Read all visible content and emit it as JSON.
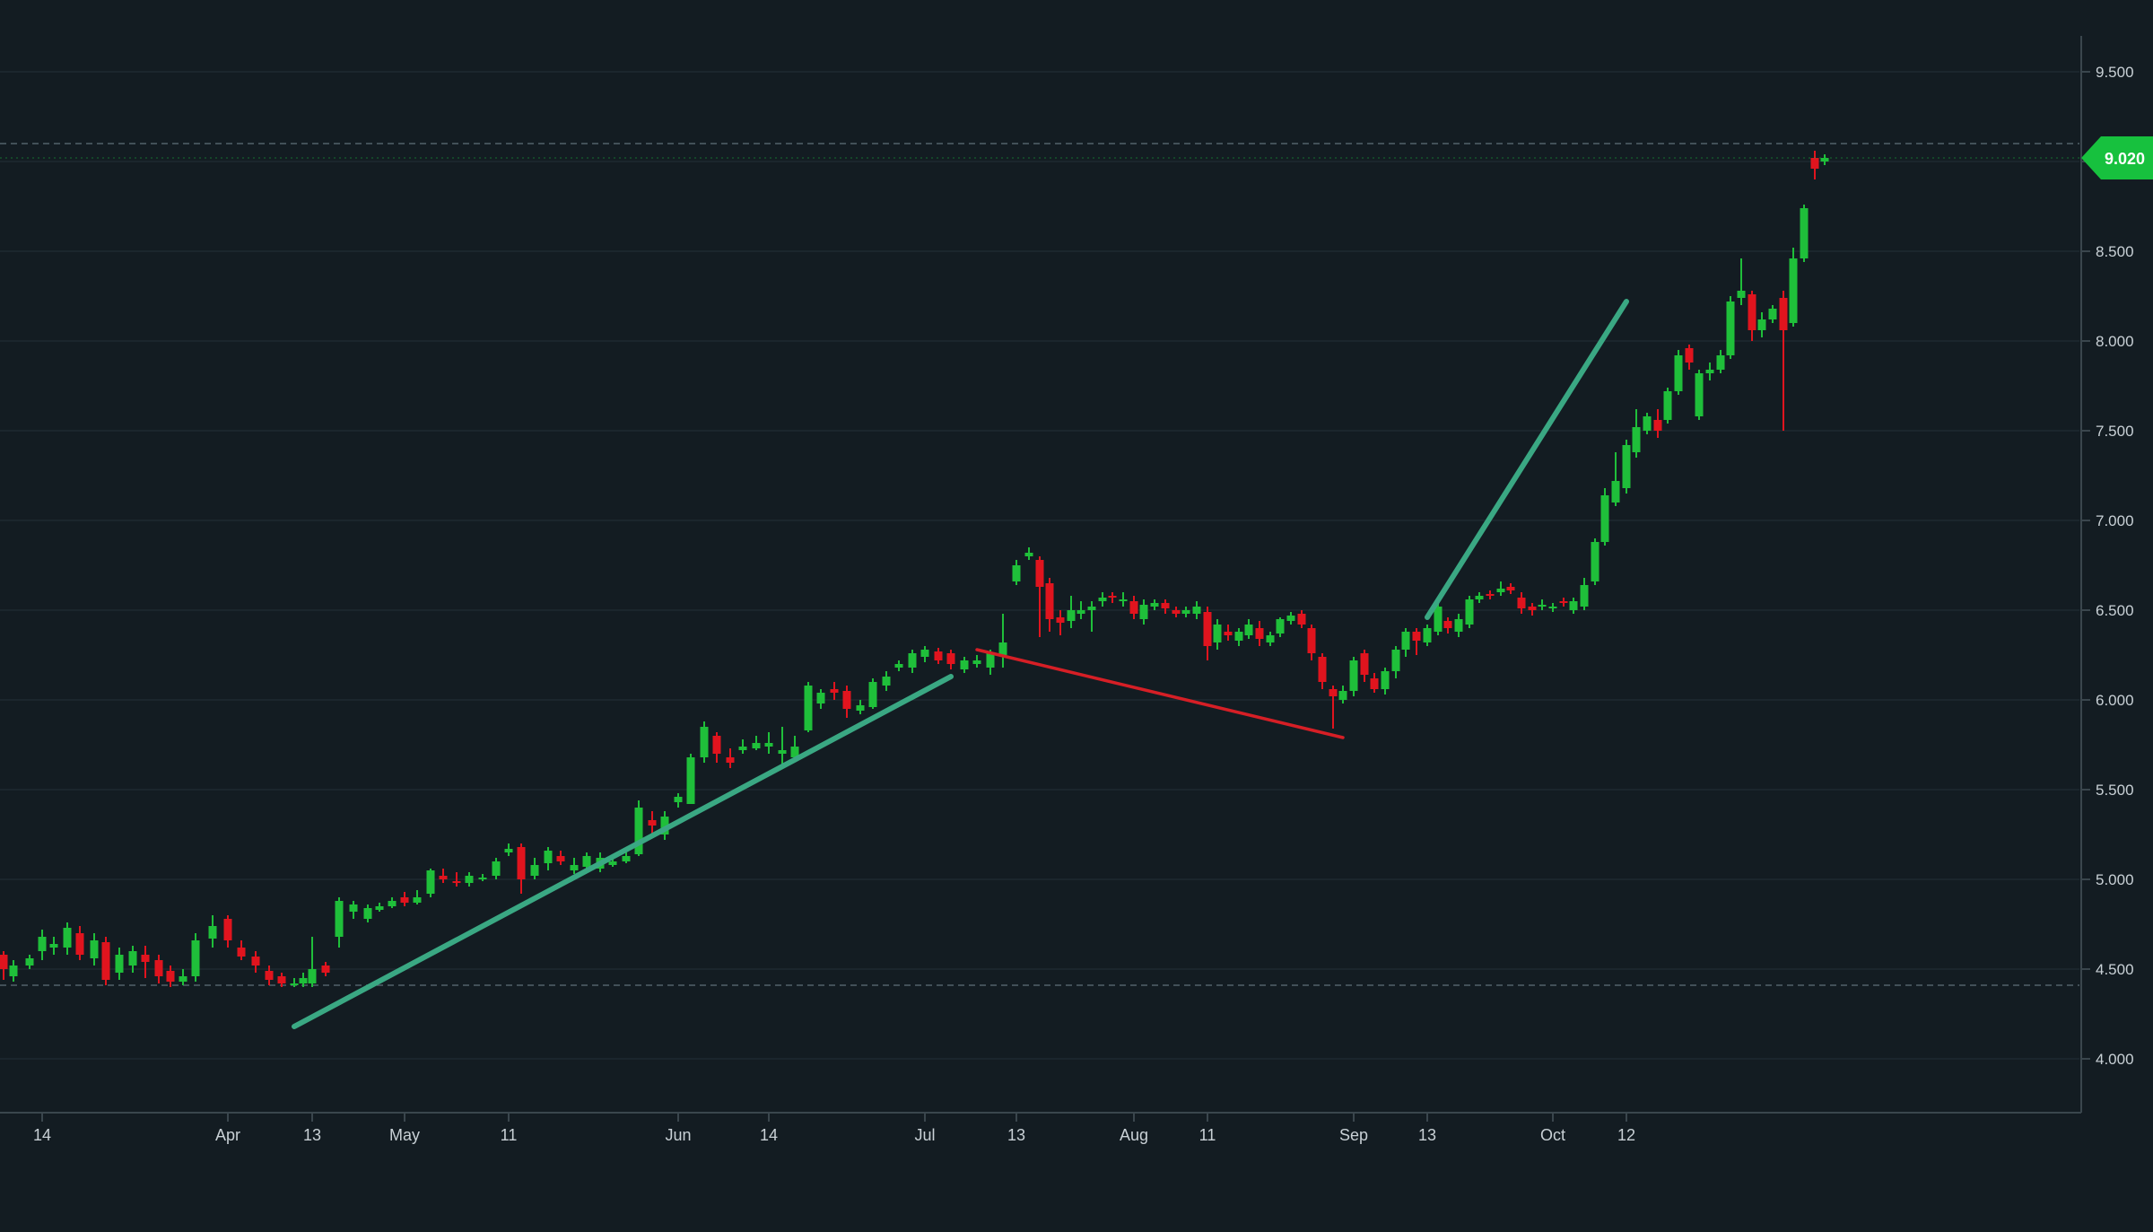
{
  "chart_data": {
    "type": "candlestick",
    "colors": {
      "background": "#131c22",
      "grid": "#1e2a31",
      "axis": "#3a464d",
      "axis_text": "#c9d1d6",
      "up": "#1fbf3a",
      "down": "#e0141e",
      "trend_up": "#3aa883",
      "trend_down": "#d61f26",
      "last_price_bg": "#17c13e",
      "last_price_text": "#ffffff",
      "dashed": "#52616a"
    },
    "y_axis": {
      "min": 3.7,
      "max": 9.6,
      "ticks": [
        "4.000",
        "4.500",
        "5.000",
        "5.500",
        "6.000",
        "6.500",
        "7.000",
        "7.500",
        "8.000",
        "8.500",
        "9.000",
        "9.500"
      ],
      "tick_values": [
        4.0,
        4.5,
        5.0,
        5.5,
        6.0,
        6.5,
        7.0,
        7.5,
        8.0,
        8.5,
        9.0,
        9.5
      ]
    },
    "x_axis": {
      "labels": [
        {
          "text": "14",
          "i": 3
        },
        {
          "text": "Apr",
          "i": 17
        },
        {
          "text": "13",
          "i": 24
        },
        {
          "text": "May",
          "i": 31
        },
        {
          "text": "11",
          "i": 39
        },
        {
          "text": "Jun",
          "i": 52
        },
        {
          "text": "14",
          "i": 59
        },
        {
          "text": "Jul",
          "i": 71
        },
        {
          "text": "13",
          "i": 78
        },
        {
          "text": "Aug",
          "i": 89
        },
        {
          "text": "11",
          "i": 96
        },
        {
          "text": "Sep",
          "i": 110
        },
        {
          "text": "13",
          "i": 117
        },
        {
          "text": "Oct",
          "i": 129
        },
        {
          "text": "12",
          "i": 136
        }
      ]
    },
    "reference_lines": [
      9.1,
      4.41
    ],
    "last_price": {
      "value": 9.02,
      "label": "9.020"
    },
    "trendlines": [
      {
        "from": [
          22,
          4.18
        ],
        "to": [
          73,
          6.13
        ],
        "color": "up"
      },
      {
        "from": [
          75,
          6.28
        ],
        "to": [
          109,
          5.79
        ],
        "color": "down"
      },
      {
        "from": [
          117,
          6.46
        ],
        "to": [
          136,
          8.22
        ],
        "color": "up"
      }
    ],
    "candles": [
      [
        4.58,
        4.5,
        4.6,
        4.44
      ],
      [
        4.46,
        4.52,
        4.55,
        4.43
      ],
      [
        4.52,
        4.56,
        4.58,
        4.5
      ],
      [
        4.6,
        4.68,
        4.72,
        4.55
      ],
      [
        4.62,
        4.64,
        4.68,
        4.58
      ],
      [
        4.62,
        4.73,
        4.76,
        4.58
      ],
      [
        4.7,
        4.58,
        4.74,
        4.55
      ],
      [
        4.56,
        4.66,
        4.7,
        4.52
      ],
      [
        4.65,
        4.44,
        4.68,
        4.41
      ],
      [
        4.48,
        4.58,
        4.62,
        4.44
      ],
      [
        4.52,
        4.6,
        4.63,
        4.48
      ],
      [
        4.58,
        4.54,
        4.63,
        4.45
      ],
      [
        4.55,
        4.46,
        4.58,
        4.42
      ],
      [
        4.49,
        4.43,
        4.52,
        4.4
      ],
      [
        4.43,
        4.46,
        4.5,
        4.41
      ],
      [
        4.46,
        4.66,
        4.7,
        4.43
      ],
      [
        4.67,
        4.74,
        4.8,
        4.62
      ],
      [
        4.78,
        4.66,
        4.8,
        4.62
      ],
      [
        4.62,
        4.57,
        4.66,
        4.55
      ],
      [
        4.57,
        4.52,
        4.6,
        4.48
      ],
      [
        4.49,
        4.44,
        4.52,
        4.41
      ],
      [
        4.46,
        4.42,
        4.48,
        4.4
      ],
      [
        4.42,
        4.42,
        4.45,
        4.4
      ],
      [
        4.42,
        4.45,
        4.48,
        4.4
      ],
      [
        4.42,
        4.5,
        4.68,
        4.4
      ],
      [
        4.52,
        4.48,
        4.54,
        4.46
      ],
      [
        4.68,
        4.88,
        4.9,
        4.62
      ],
      [
        4.82,
        4.86,
        4.88,
        4.78
      ],
      [
        4.78,
        4.84,
        4.86,
        4.76
      ],
      [
        4.83,
        4.85,
        4.87,
        4.82
      ],
      [
        4.85,
        4.88,
        4.9,
        4.84
      ],
      [
        4.9,
        4.87,
        4.93,
        4.85
      ],
      [
        4.87,
        4.9,
        4.94,
        4.86
      ],
      [
        4.92,
        5.05,
        5.06,
        4.9
      ],
      [
        5.02,
        5.0,
        5.06,
        4.98
      ],
      [
        4.99,
        4.98,
        5.04,
        4.96
      ],
      [
        4.98,
        5.02,
        5.04,
        4.96
      ],
      [
        5.0,
        5.01,
        5.03,
        4.99
      ],
      [
        5.02,
        5.1,
        5.12,
        5.0
      ],
      [
        5.15,
        5.17,
        5.2,
        5.13
      ],
      [
        5.18,
        5.0,
        5.2,
        4.92
      ],
      [
        5.02,
        5.08,
        5.12,
        5.0
      ],
      [
        5.09,
        5.16,
        5.18,
        5.05
      ],
      [
        5.13,
        5.1,
        5.16,
        5.08
      ],
      [
        5.05,
        5.08,
        5.12,
        5.03
      ],
      [
        5.07,
        5.13,
        5.15,
        5.05
      ],
      [
        5.06,
        5.12,
        5.15,
        5.04
      ],
      [
        5.08,
        5.1,
        5.12,
        5.07
      ],
      [
        5.1,
        5.13,
        5.15,
        5.09
      ],
      [
        5.14,
        5.4,
        5.44,
        5.13
      ],
      [
        5.33,
        5.3,
        5.38,
        5.25
      ],
      [
        5.25,
        5.35,
        5.38,
        5.22
      ],
      [
        5.43,
        5.46,
        5.48,
        5.4
      ],
      [
        5.42,
        5.68,
        5.7,
        5.42
      ],
      [
        5.68,
        5.85,
        5.88,
        5.65
      ],
      [
        5.8,
        5.7,
        5.82,
        5.65
      ],
      [
        5.68,
        5.65,
        5.73,
        5.62
      ],
      [
        5.72,
        5.74,
        5.78,
        5.7
      ],
      [
        5.73,
        5.76,
        5.8,
        5.72
      ],
      [
        5.74,
        5.76,
        5.82,
        5.7
      ],
      [
        5.7,
        5.72,
        5.85,
        5.64
      ],
      [
        5.68,
        5.74,
        5.8,
        5.66
      ],
      [
        5.83,
        6.08,
        6.1,
        5.82
      ],
      [
        5.98,
        6.04,
        6.06,
        5.95
      ],
      [
        6.06,
        6.04,
        6.1,
        6.0
      ],
      [
        6.05,
        5.95,
        6.08,
        5.9
      ],
      [
        5.94,
        5.97,
        6.0,
        5.92
      ],
      [
        5.96,
        6.1,
        6.12,
        5.95
      ],
      [
        6.08,
        6.13,
        6.16,
        6.05
      ],
      [
        6.18,
        6.2,
        6.22,
        6.16
      ],
      [
        6.18,
        6.26,
        6.28,
        6.15
      ],
      [
        6.24,
        6.28,
        6.3,
        6.21
      ],
      [
        6.27,
        6.22,
        6.29,
        6.2
      ],
      [
        6.26,
        6.2,
        6.28,
        6.17
      ],
      [
        6.17,
        6.22,
        6.24,
        6.15
      ],
      [
        6.2,
        6.22,
        6.25,
        6.18
      ],
      [
        6.18,
        6.26,
        6.28,
        6.14
      ],
      [
        6.25,
        6.32,
        6.48,
        6.18
      ],
      [
        6.66,
        6.75,
        6.78,
        6.64
      ],
      [
        6.8,
        6.82,
        6.85,
        6.78
      ],
      [
        6.78,
        6.63,
        6.8,
        6.35
      ],
      [
        6.65,
        6.45,
        6.68,
        6.38
      ],
      [
        6.46,
        6.43,
        6.5,
        6.36
      ],
      [
        6.44,
        6.5,
        6.58,
        6.4
      ],
      [
        6.48,
        6.5,
        6.55,
        6.45
      ],
      [
        6.5,
        6.52,
        6.55,
        6.38
      ],
      [
        6.55,
        6.57,
        6.6,
        6.52
      ],
      [
        6.58,
        6.57,
        6.6,
        6.54
      ],
      [
        6.55,
        6.56,
        6.6,
        6.52
      ],
      [
        6.55,
        6.48,
        6.58,
        6.45
      ],
      [
        6.45,
        6.53,
        6.56,
        6.42
      ],
      [
        6.52,
        6.54,
        6.56,
        6.5
      ],
      [
        6.54,
        6.51,
        6.56,
        6.48
      ],
      [
        6.5,
        6.48,
        6.52,
        6.46
      ],
      [
        6.48,
        6.5,
        6.52,
        6.46
      ],
      [
        6.48,
        6.52,
        6.55,
        6.45
      ],
      [
        6.49,
        6.3,
        6.52,
        6.22
      ],
      [
        6.32,
        6.42,
        6.45,
        6.28
      ],
      [
        6.38,
        6.36,
        6.42,
        6.33
      ],
      [
        6.33,
        6.38,
        6.4,
        6.3
      ],
      [
        6.36,
        6.42,
        6.45,
        6.34
      ],
      [
        6.4,
        6.34,
        6.44,
        6.3
      ],
      [
        6.32,
        6.36,
        6.38,
        6.3
      ],
      [
        6.37,
        6.45,
        6.46,
        6.35
      ],
      [
        6.44,
        6.47,
        6.49,
        6.42
      ],
      [
        6.48,
        6.42,
        6.5,
        6.4
      ],
      [
        6.4,
        6.26,
        6.42,
        6.22
      ],
      [
        6.24,
        6.1,
        6.26,
        6.06
      ],
      [
        6.06,
        6.02,
        6.08,
        5.84
      ],
      [
        6.0,
        6.05,
        6.08,
        5.98
      ],
      [
        6.05,
        6.22,
        6.24,
        6.02
      ],
      [
        6.26,
        6.14,
        6.28,
        6.1
      ],
      [
        6.12,
        6.06,
        6.15,
        6.04
      ],
      [
        6.06,
        6.16,
        6.18,
        6.03
      ],
      [
        6.16,
        6.28,
        6.3,
        6.12
      ],
      [
        6.28,
        6.38,
        6.4,
        6.24
      ],
      [
        6.38,
        6.33,
        6.4,
        6.25
      ],
      [
        6.32,
        6.4,
        6.42,
        6.3
      ],
      [
        6.38,
        6.52,
        6.55,
        6.36
      ],
      [
        6.44,
        6.4,
        6.46,
        6.37
      ],
      [
        6.38,
        6.45,
        6.48,
        6.35
      ],
      [
        6.42,
        6.56,
        6.58,
        6.4
      ],
      [
        6.56,
        6.58,
        6.6,
        6.54
      ],
      [
        6.59,
        6.58,
        6.61,
        6.56
      ],
      [
        6.6,
        6.62,
        6.66,
        6.58
      ],
      [
        6.63,
        6.61,
        6.65,
        6.59
      ],
      [
        6.57,
        6.51,
        6.6,
        6.48
      ],
      [
        6.52,
        6.5,
        6.54,
        6.47
      ],
      [
        6.52,
        6.53,
        6.56,
        6.5
      ],
      [
        6.52,
        6.52,
        6.54,
        6.49
      ],
      [
        6.55,
        6.54,
        6.57,
        6.52
      ],
      [
        6.5,
        6.55,
        6.57,
        6.48
      ],
      [
        6.52,
        6.64,
        6.68,
        6.5
      ],
      [
        6.66,
        6.88,
        6.9,
        6.64
      ],
      [
        6.88,
        7.14,
        7.18,
        6.86
      ],
      [
        7.1,
        7.22,
        7.38,
        7.08
      ],
      [
        7.18,
        7.42,
        7.45,
        7.15
      ],
      [
        7.38,
        7.52,
        7.62,
        7.35
      ],
      [
        7.5,
        7.58,
        7.6,
        7.48
      ],
      [
        7.56,
        7.5,
        7.62,
        7.46
      ],
      [
        7.56,
        7.72,
        7.74,
        7.54
      ],
      [
        7.72,
        7.92,
        7.95,
        7.7
      ],
      [
        7.96,
        7.88,
        7.98,
        7.84
      ],
      [
        7.58,
        7.82,
        7.84,
        7.56
      ],
      [
        7.82,
        7.84,
        7.88,
        7.78
      ],
      [
        7.84,
        7.92,
        7.95,
        7.82
      ],
      [
        7.92,
        8.22,
        8.25,
        7.9
      ],
      [
        8.24,
        8.28,
        8.46,
        8.2
      ],
      [
        8.26,
        8.06,
        8.28,
        8.0
      ],
      [
        8.06,
        8.12,
        8.16,
        8.02
      ],
      [
        8.12,
        8.18,
        8.2,
        8.1
      ],
      [
        8.24,
        8.06,
        8.28,
        7.5
      ],
      [
        8.1,
        8.46,
        8.52,
        8.08
      ],
      [
        8.46,
        8.74,
        8.76,
        8.44
      ],
      [
        9.02,
        8.96,
        9.06,
        8.9
      ],
      [
        9.0,
        9.02,
        9.04,
        8.98
      ]
    ],
    "candle_x": [
      4,
      15,
      33,
      47,
      60,
      75,
      89,
      105,
      118,
      133,
      148,
      162,
      177,
      190,
      204,
      218,
      237,
      254,
      269,
      285,
      300,
      314,
      328,
      338,
      348,
      363,
      378,
      394,
      410,
      423,
      437,
      451,
      465,
      480,
      494,
      509,
      523,
      538,
      553,
      567,
      581,
      596,
      611,
      625,
      640,
      654,
      669,
      683,
      698,
      712,
      727,
      741,
      756,
      770,
      785,
      799,
      814,
      828,
      843,
      857,
      872,
      886,
      901,
      915,
      930,
      944,
      959,
      973,
      988,
      1002,
      1017,
      1031,
      1046,
      1060,
      1075,
      1089,
      1104,
      1118,
      1133,
      1147,
      1159,
      1170,
      1182,
      1194,
      1205,
      1217,
      1229,
      1240,
      1252,
      1264,
      1275,
      1287,
      1299,
      1311,
      1322,
      1334,
      1346,
      1357,
      1369,
      1381,
      1392,
      1404,
      1416,
      1427,
      1439,
      1451,
      1462,
      1474,
      1486,
      1497,
      1509,
      1521,
      1532,
      1544,
      1556,
      1567,
      1579,
      1591,
      1603,
      1614,
      1626,
      1638,
      1649,
      1661,
      1673,
      1684,
      1696,
      1708,
      1719,
      1731,
      1743,
      1754,
      1766,
      1778,
      1789,
      1801,
      1813,
      1824,
      1836,
      1848,
      1859,
      1871,
      1883,
      1894,
      1906,
      1918,
      1929,
      1941,
      1953,
      1964,
      1976,
      1988,
      1999,
      2011,
      2023,
      2034,
      2046,
      2058,
      2069,
      2081,
      2093,
      2104,
      2116,
      2128,
      2139,
      2151,
      2163,
      2174,
      2186,
      2198,
      2209,
      2221,
      2233,
      2244,
      2256,
      2268,
      2279,
      2291,
      2303,
      2314
    ]
  }
}
